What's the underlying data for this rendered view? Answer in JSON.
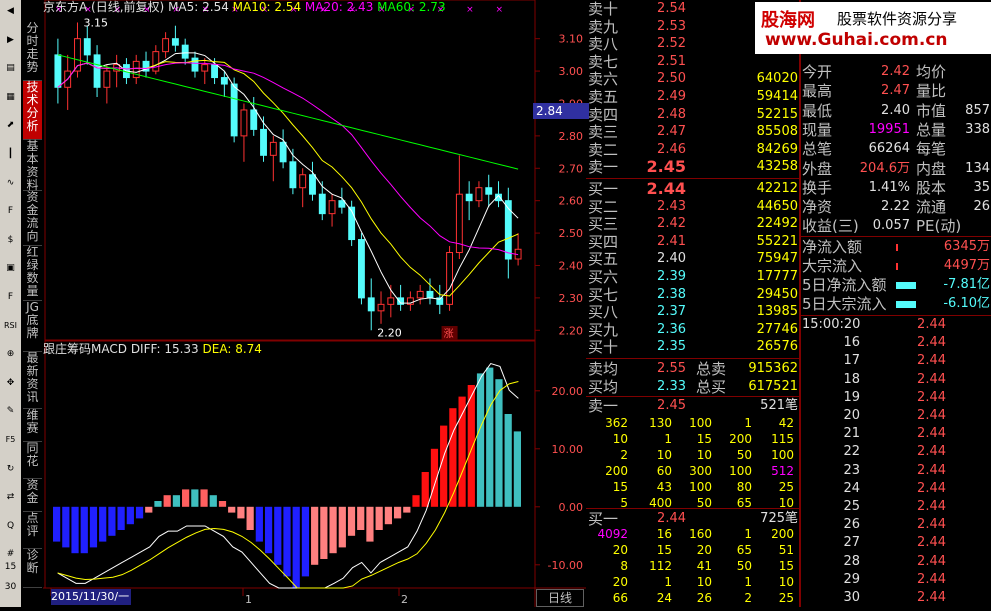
{
  "toolbar_icons": [
    "back-icon",
    "forward-icon",
    "list-icon",
    "table-icon",
    "chart-icon",
    "kline-icon",
    "trend-icon",
    "f10-icon",
    "fund-icon",
    "index-icon",
    "f10b-icon",
    "rsi-icon",
    "zoom-in-icon",
    "move-icon",
    "draw-icon",
    "f5-icon",
    "refresh-icon",
    "compare-icon",
    "quote-icon",
    "numbers-icon"
  ],
  "toolbar_labels": {
    "rsi": "RSI",
    "f5": "F5",
    "n15": "15",
    "n30": "30"
  },
  "vtabs": [
    {
      "label": "分时走势",
      "active": false
    },
    {
      "label": "技术分析",
      "active": true
    },
    {
      "label": "基本资料",
      "active": false
    },
    {
      "label": "资金流向",
      "active": false
    },
    {
      "label": "红绿数量",
      "active": false
    },
    {
      "label": "JG底牌",
      "active": false
    },
    {
      "label": "最新资讯",
      "active": false
    },
    {
      "label": "维赛",
      "active": false
    },
    {
      "label": "同花",
      "active": false
    },
    {
      "label": "资金",
      "active": false
    },
    {
      "label": "点评",
      "active": false
    },
    {
      "label": "诊断",
      "active": false
    }
  ],
  "kline": {
    "header_name": "京东方A",
    "header_mode": "(日线,前复权)",
    "ma5": "MA5: 2.54",
    "ma10": "MA10: 2.54",
    "ma20": "MA20: 2.43",
    "ma60": "MA60: 2.73",
    "high_label": "3.15",
    "low_label": "2.20",
    "zhang": "涨",
    "current_price_tag": "2.84",
    "yticks": [
      "3.10",
      "3.00",
      "2.90",
      "2.80",
      "2.70",
      "2.60",
      "2.50",
      "2.40",
      "2.30",
      "2.20"
    ],
    "date_label": "2015/11/30/一",
    "x_marks": [
      "2",
      "1",
      "2"
    ],
    "period_button": "日线"
  },
  "chart_data": [
    {
      "type": "candlestick",
      "title": "京东方A (日线,前复权)",
      "ylim": [
        2.17,
        3.17
      ],
      "yticks": [
        3.1,
        3.0,
        2.9,
        2.8,
        2.7,
        2.6,
        2.5,
        2.4,
        2.3,
        2.2
      ],
      "ohlc": [
        [
          3.05,
          3.1,
          2.9,
          2.95
        ],
        [
          2.95,
          3.05,
          2.88,
          3.0
        ],
        [
          3.0,
          3.15,
          2.98,
          3.1
        ],
        [
          3.1,
          3.14,
          3.02,
          3.05
        ],
        [
          3.05,
          3.08,
          2.92,
          2.95
        ],
        [
          2.95,
          3.02,
          2.9,
          3.0
        ],
        [
          3.0,
          3.05,
          2.95,
          3.02
        ],
        [
          3.02,
          3.04,
          2.96,
          2.98
        ],
        [
          2.98,
          3.05,
          2.96,
          3.03
        ],
        [
          3.03,
          3.06,
          2.98,
          3.0
        ],
        [
          3.0,
          3.08,
          2.99,
          3.06
        ],
        [
          3.06,
          3.12,
          3.04,
          3.1
        ],
        [
          3.1,
          3.14,
          3.06,
          3.08
        ],
        [
          3.08,
          3.1,
          3.02,
          3.04
        ],
        [
          3.04,
          3.06,
          2.98,
          3.0
        ],
        [
          3.0,
          3.04,
          2.96,
          3.02
        ],
        [
          3.02,
          3.04,
          2.96,
          2.98
        ],
        [
          2.98,
          3.0,
          2.92,
          2.96
        ],
        [
          2.96,
          2.98,
          2.78,
          2.8
        ],
        [
          2.8,
          2.9,
          2.72,
          2.88
        ],
        [
          2.88,
          2.92,
          2.8,
          2.82
        ],
        [
          2.82,
          2.86,
          2.72,
          2.74
        ],
        [
          2.74,
          2.8,
          2.66,
          2.78
        ],
        [
          2.78,
          2.82,
          2.7,
          2.72
        ],
        [
          2.72,
          2.76,
          2.62,
          2.64
        ],
        [
          2.64,
          2.7,
          2.58,
          2.68
        ],
        [
          2.68,
          2.72,
          2.6,
          2.62
        ],
        [
          2.62,
          2.66,
          2.54,
          2.56
        ],
        [
          2.56,
          2.62,
          2.52,
          2.6
        ],
        [
          2.6,
          2.64,
          2.56,
          2.58
        ],
        [
          2.58,
          2.6,
          2.46,
          2.48
        ],
        [
          2.48,
          2.5,
          2.28,
          2.3
        ],
        [
          2.3,
          2.36,
          2.2,
          2.26
        ],
        [
          2.26,
          2.32,
          2.22,
          2.28
        ],
        [
          2.28,
          2.34,
          2.24,
          2.3
        ],
        [
          2.3,
          2.34,
          2.26,
          2.28
        ],
        [
          2.28,
          2.32,
          2.26,
          2.3
        ],
        [
          2.3,
          2.34,
          2.28,
          2.32
        ],
        [
          2.32,
          2.36,
          2.28,
          2.3
        ],
        [
          2.3,
          2.34,
          2.25,
          2.28
        ],
        [
          2.28,
          2.46,
          2.26,
          2.44
        ],
        [
          2.44,
          2.74,
          2.42,
          2.62
        ],
        [
          2.62,
          2.66,
          2.54,
          2.6
        ],
        [
          2.6,
          2.66,
          2.58,
          2.64
        ],
        [
          2.64,
          2.68,
          2.58,
          2.62
        ],
        [
          2.62,
          2.66,
          2.58,
          2.6
        ],
        [
          2.6,
          2.64,
          2.36,
          2.42
        ],
        [
          2.42,
          2.5,
          2.4,
          2.45
        ]
      ],
      "ma_series": [
        {
          "name": "MA5",
          "color": "#ffffff"
        },
        {
          "name": "MA10",
          "color": "#ffff00"
        },
        {
          "name": "MA20",
          "color": "#ff00ff"
        },
        {
          "name": "MA60",
          "color": "#00ff00"
        }
      ]
    },
    {
      "type": "bar",
      "title": "跟庄筹码MACD",
      "diff_label": "DIFF: 15.33",
      "dea_label": "DEA: 8.74",
      "ylim": [
        -14,
        26
      ],
      "yticks": [
        "20.00",
        "10.00",
        "0.00",
        "-10.00"
      ],
      "values": [
        -6,
        -7,
        -8,
        -8,
        -7,
        -6,
        -5,
        -4,
        -3,
        -2,
        -1,
        1,
        2,
        2,
        3,
        3,
        3,
        2,
        1,
        -1,
        -2,
        -4,
        -6,
        -8,
        -10,
        -12,
        -14,
        -12,
        -10,
        -9,
        -8,
        -7,
        -5,
        -4,
        -6,
        -4,
        -3,
        -2,
        -1,
        2,
        6,
        10,
        14,
        17,
        19,
        21,
        23,
        24,
        22,
        16,
        13
      ]
    }
  ],
  "orderbook": {
    "sell": [
      {
        "label": "卖十",
        "price": "2.54",
        "vol": ""
      },
      {
        "label": "卖九",
        "price": "2.53",
        "vol": ""
      },
      {
        "label": "卖八",
        "price": "2.52",
        "vol": ""
      },
      {
        "label": "卖七",
        "price": "2.51",
        "vol": ""
      },
      {
        "label": "卖六",
        "price": "2.50",
        "vol": "64020"
      },
      {
        "label": "卖五",
        "price": "2.49",
        "vol": "59414"
      },
      {
        "label": "卖四",
        "price": "2.48",
        "vol": "52215"
      },
      {
        "label": "卖三",
        "price": "2.47",
        "vol": "85508"
      },
      {
        "label": "卖二",
        "price": "2.46",
        "vol": "84269"
      },
      {
        "label": "卖一",
        "price": "2.45",
        "vol": "43258"
      }
    ],
    "buy": [
      {
        "label": "买一",
        "price": "2.44",
        "vol": "42212"
      },
      {
        "label": "买二",
        "price": "2.43",
        "vol": "44650"
      },
      {
        "label": "买三",
        "price": "2.42",
        "vol": "22492"
      },
      {
        "label": "买四",
        "price": "2.41",
        "vol": "55221"
      },
      {
        "label": "买五",
        "price": "2.40",
        "vol": "75947"
      },
      {
        "label": "买六",
        "price": "2.39",
        "vol": "17777"
      },
      {
        "label": "买七",
        "price": "2.38",
        "vol": "29450"
      },
      {
        "label": "买八",
        "price": "2.37",
        "vol": "13985"
      },
      {
        "label": "买九",
        "price": "2.36",
        "vol": "27746"
      },
      {
        "label": "买十",
        "price": "2.35",
        "vol": "26576"
      }
    ],
    "avg_sell_label": "卖均",
    "avg_sell": "2.55",
    "total_sell_label": "总卖",
    "total_sell": "915362",
    "avg_buy_label": "买均",
    "avg_buy": "2.33",
    "total_buy_label": "总买",
    "total_buy": "617521",
    "sell1_label": "卖一",
    "sell1_price": "2.45",
    "sell1_count": "521笔",
    "sell1_grid": [
      [
        "362",
        "130",
        "100",
        "1",
        "42"
      ],
      [
        "10",
        "1",
        "15",
        "200",
        "115"
      ],
      [
        "2",
        "10",
        "10",
        "50",
        "100"
      ],
      [
        "200",
        "60",
        "300",
        "100",
        "512"
      ],
      [
        "15",
        "43",
        "100",
        "80",
        "25"
      ],
      [
        "5",
        "400",
        "50",
        "65",
        "10"
      ]
    ],
    "buy1_label": "买一",
    "buy1_price": "2.44",
    "buy1_count": "725笔",
    "buy1_grid": [
      [
        "4092",
        "16",
        "160",
        "1",
        "200"
      ],
      [
        "20",
        "15",
        "20",
        "65",
        "51"
      ],
      [
        "8",
        "112",
        "41",
        "50",
        "15"
      ],
      [
        "20",
        "1",
        "10",
        "1",
        "10"
      ],
      [
        "66",
        "24",
        "26",
        "2",
        "25"
      ]
    ]
  },
  "stats": [
    {
      "l1": "今开",
      "v1": "2.42",
      "l2": "均价",
      "v2": ""
    },
    {
      "l1": "最高",
      "v1": "2.47",
      "l2": "量比",
      "v2": ""
    },
    {
      "l1": "最低",
      "v1": "2.40",
      "l2": "市值",
      "v2": "857"
    },
    {
      "l1": "现量",
      "v1": "19951",
      "l2": "总量",
      "v2": "338"
    },
    {
      "l1": "总笔",
      "v1": "66264",
      "l2": "每笔",
      "v2": ""
    },
    {
      "l1": "外盘",
      "v1": "204.6万",
      "l2": "内盘",
      "v2": "134"
    },
    {
      "l1": "换手",
      "v1": "1.41%",
      "l2": "股本",
      "v2": "35"
    },
    {
      "l1": "净资",
      "v1": "2.22",
      "l2": "流通",
      "v2": "26"
    },
    {
      "l1": "收益(三)",
      "v1": "0.057",
      "l2": "PE(动)",
      "v2": ""
    }
  ],
  "flows": [
    {
      "label": "净流入额",
      "value": "6345万"
    },
    {
      "label": "大宗流入",
      "value": "4497万"
    },
    {
      "label": "5日净流入额",
      "value": "-7.81亿"
    },
    {
      "label": "5日大宗流入",
      "value": "-6.10亿"
    }
  ],
  "ticks": {
    "first_time": "15:00:20",
    "rows": [
      {
        "t": "15:00:20",
        "p": "2.44"
      },
      {
        "t": "16",
        "p": "2.44"
      },
      {
        "t": "17",
        "p": "2.44"
      },
      {
        "t": "18",
        "p": "2.44"
      },
      {
        "t": "19",
        "p": "2.44"
      },
      {
        "t": "20",
        "p": "2.44"
      },
      {
        "t": "21",
        "p": "2.44"
      },
      {
        "t": "22",
        "p": "2.44"
      },
      {
        "t": "23",
        "p": "2.44"
      },
      {
        "t": "24",
        "p": "2.44"
      },
      {
        "t": "25",
        "p": "2.44"
      },
      {
        "t": "26",
        "p": "2.44"
      },
      {
        "t": "27",
        "p": "2.44"
      },
      {
        "t": "28",
        "p": "2.44"
      },
      {
        "t": "29",
        "p": "2.44"
      },
      {
        "t": "30",
        "p": "2.44"
      }
    ]
  },
  "logo": {
    "brand": "股海网",
    "slogan": "股票软件资源分享",
    "url": "www.Guhai.com.cn"
  },
  "colors": {
    "up": "#ff3232",
    "down": "#54fcfc",
    "grid": "#800000",
    "bg": "#000000"
  }
}
